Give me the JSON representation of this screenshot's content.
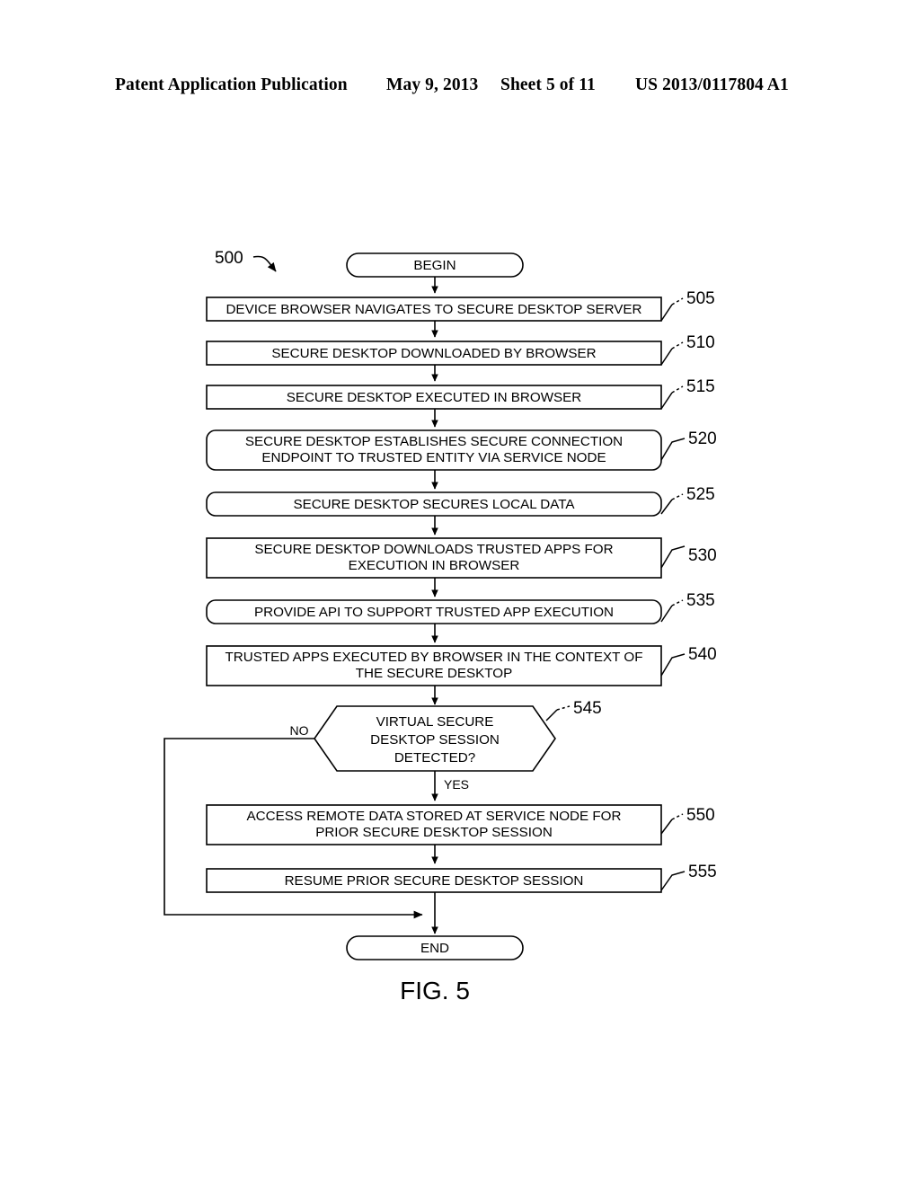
{
  "header": {
    "publication": "Patent Application Publication",
    "date": "May 9, 2013",
    "sheet": "Sheet 5 of 11",
    "patent_number": "US 2013/0117804 A1"
  },
  "figure": {
    "caption": "FIG. 5",
    "diagram_label": "500",
    "terminators": {
      "begin": "BEGIN",
      "end": "END"
    },
    "branch_labels": {
      "no": "NO",
      "yes": "YES"
    },
    "steps": [
      {
        "ref": "505",
        "shape": "rect",
        "lines": [
          "DEVICE BROWSER NAVIGATES TO SECURE DESKTOP SERVER"
        ]
      },
      {
        "ref": "510",
        "shape": "rect",
        "lines": [
          "SECURE DESKTOP DOWNLOADED BY BROWSER"
        ]
      },
      {
        "ref": "515",
        "shape": "rect",
        "lines": [
          "SECURE DESKTOP  EXECUTED IN BROWSER"
        ]
      },
      {
        "ref": "520",
        "shape": "rounded",
        "lines": [
          "SECURE DESKTOP ESTABLISHES SECURE CONNECTION",
          "ENDPOINT TO TRUSTED ENTITY VIA SERVICE NODE"
        ]
      },
      {
        "ref": "525",
        "shape": "rounded",
        "lines": [
          "SECURE DESKTOP SECURES LOCAL DATA"
        ]
      },
      {
        "ref": "530",
        "shape": "rect",
        "lines": [
          "SECURE DESKTOP DOWNLOADS TRUSTED APPS FOR",
          "EXECUTION IN BROWSER"
        ]
      },
      {
        "ref": "535",
        "shape": "rounded",
        "lines": [
          "PROVIDE API TO SUPPORT TRUSTED APP EXECUTION"
        ]
      },
      {
        "ref": "540",
        "shape": "rect",
        "lines": [
          "TRUSTED APPS EXECUTED BY BROWSER IN THE CONTEXT OF",
          "THE SECURE DESKTOP"
        ]
      },
      {
        "ref": "545",
        "shape": "hexagon",
        "lines": [
          "VIRTUAL SECURE",
          "DESKTOP SESSION",
          "DETECTED?"
        ]
      },
      {
        "ref": "550",
        "shape": "rect",
        "lines": [
          "ACCESS REMOTE DATA  STORED AT SERVICE NODE FOR",
          "PRIOR SECURE DESKTOP SESSION"
        ]
      },
      {
        "ref": "555",
        "shape": "rect",
        "lines": [
          "RESUME PRIOR SECURE DESKTOP SESSION"
        ]
      }
    ]
  }
}
